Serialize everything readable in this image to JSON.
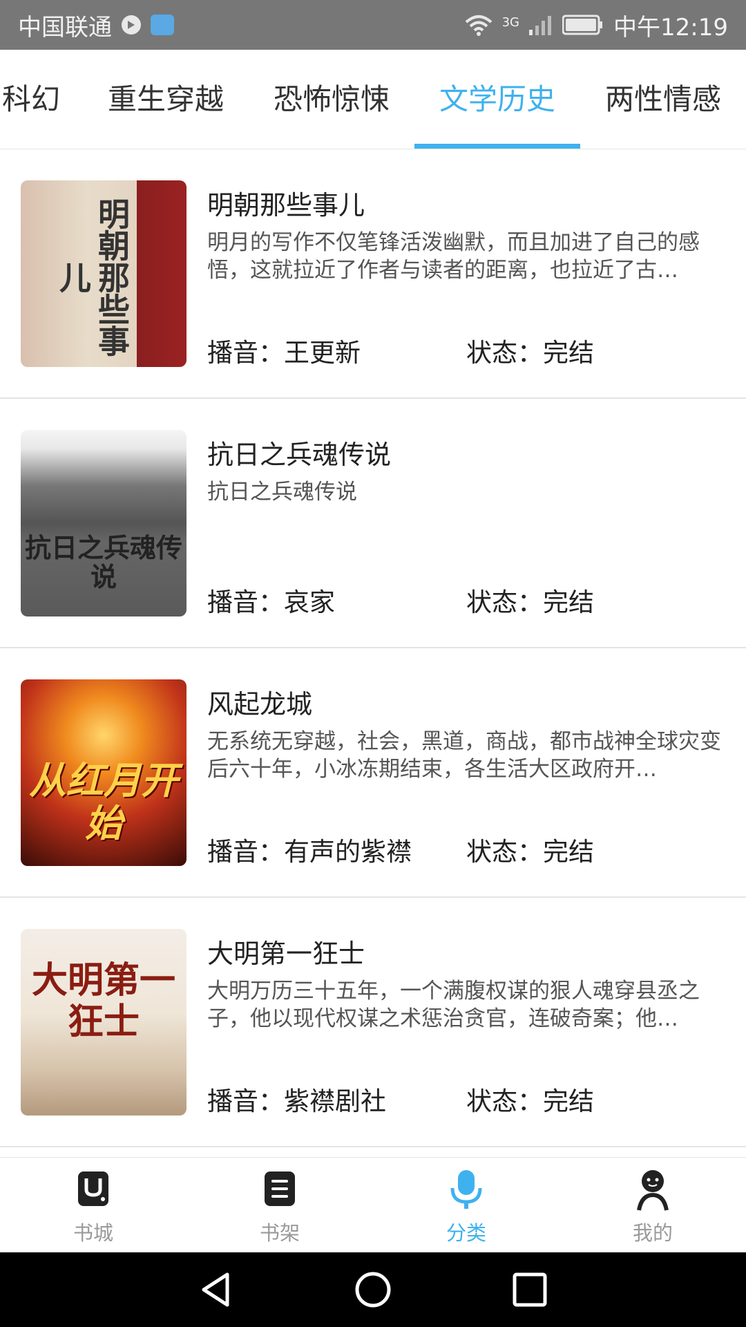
{
  "status_bar": {
    "carrier": "中国联通",
    "network": "3G",
    "time": "中午12:19"
  },
  "tabs": [
    {
      "label": "科幻",
      "active": false
    },
    {
      "label": "重生穿越",
      "active": false
    },
    {
      "label": "恐怖惊悚",
      "active": false
    },
    {
      "label": "文学历史",
      "active": true
    },
    {
      "label": "两性情感",
      "active": false
    }
  ],
  "books": [
    {
      "title": "明朝那些事儿",
      "description": "明月的写作不仅笔锋活泼幽默，而且加进了自己的感悟，这就拉近了作者与读者的距离，也拉近了古…",
      "narrator_label": "播音：",
      "narrator": "王更新",
      "status_label": "状态：",
      "status": "完结",
      "cover_text": "明朝那些事儿"
    },
    {
      "title": "抗日之兵魂传说",
      "description": "抗日之兵魂传说",
      "narrator_label": "播音：",
      "narrator": "哀家",
      "status_label": "状态：",
      "status": "完结",
      "cover_text": "抗日之兵魂传说"
    },
    {
      "title": "风起龙城",
      "description": "无系统无穿越，社会，黑道，商战，都市战神全球灾变后六十年，小冰冻期结束，各生活大区政府开…",
      "narrator_label": "播音：",
      "narrator": "有声的紫襟",
      "status_label": "状态：",
      "status": "完结",
      "cover_text": "从红月开始"
    },
    {
      "title": "大明第一狂士",
      "description": "大明万历三十五年，一个满腹权谋的狠人魂穿县丞之子，他以现代权谋之术惩治贪官，连破奇案；他…",
      "narrator_label": "播音：",
      "narrator": "紫襟剧社",
      "status_label": "状态：",
      "status": "完结",
      "cover_text": "大明第一狂士"
    }
  ],
  "bottom_nav": [
    {
      "label": "书城",
      "icon": "store-icon",
      "active": false
    },
    {
      "label": "书架",
      "icon": "bookshelf-icon",
      "active": false
    },
    {
      "label": "分类",
      "icon": "microphone-icon",
      "active": true
    },
    {
      "label": "我的",
      "icon": "profile-icon",
      "active": false
    }
  ],
  "colors": {
    "accent": "#3fb1ef",
    "status_bar": "#777777",
    "text": "#222222",
    "inactive_nav": "#9a9a9a"
  }
}
